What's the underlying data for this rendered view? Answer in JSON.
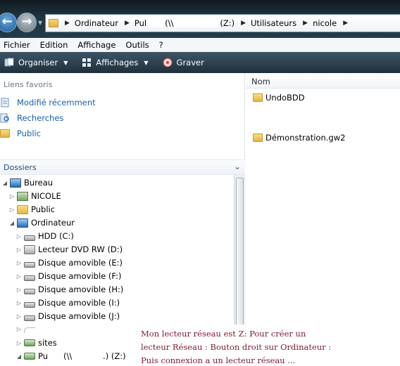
{
  "address_bar": {
    "crumbs": [
      "Ordinateur",
      "Pul",
      "(\\\\",
      "(Z:)",
      "Utilisateurs",
      "nicole"
    ]
  },
  "menu": [
    "Fichier",
    "Edition",
    "Affichage",
    "Outils",
    "?"
  ],
  "toolbar": {
    "organize": "Organiser",
    "views": "Affichages",
    "burn": "Graver"
  },
  "favorites": {
    "title": "Liens favoris",
    "items": [
      {
        "label": "Modifié récemment",
        "icon": "recent-icon"
      },
      {
        "label": "Recherches",
        "icon": "search-icon"
      },
      {
        "label": "Public",
        "icon": "folder-icon"
      }
    ]
  },
  "folders": {
    "title": "Dossiers",
    "tree": [
      {
        "label": "Bureau",
        "icon": "desktop-icon",
        "expanded": true
      },
      {
        "label": "NICOLE",
        "icon": "user-icon",
        "expanded": false
      },
      {
        "label": "Public",
        "icon": "folder-icon",
        "expanded": false
      },
      {
        "label": "Ordinateur",
        "icon": "computer-icon",
        "expanded": true
      },
      {
        "label": "HDD (C:)",
        "icon": "hdd-icon",
        "expanded": false
      },
      {
        "label": "Lecteur DVD RW (D:)",
        "icon": "dvd-icon",
        "expanded": false
      },
      {
        "label": "Disque amovible (E:)",
        "icon": "removable-icon",
        "expanded": false
      },
      {
        "label": "Disque amovible (F:)",
        "icon": "removable-icon",
        "expanded": false
      },
      {
        "label": "Disque amovible (H:)",
        "icon": "removable-icon",
        "expanded": false
      },
      {
        "label": "Disque amovible (I:)",
        "icon": "removable-icon",
        "expanded": false
      },
      {
        "label": "Disque amovible (J:)",
        "icon": "removable-icon",
        "expanded": false
      },
      {
        "label": "",
        "icon": "removable-icon",
        "expanded": false
      },
      {
        "label": "sites",
        "icon": "network-drive-icon",
        "expanded": false
      },
      {
        "label": "Pu      (\\\\            .) (Z:)",
        "icon": "network-drive-icon",
        "expanded": true
      }
    ]
  },
  "content": {
    "column_name": "Nom",
    "items": [
      "UndoBDD",
      "Démonstration.gw2"
    ]
  },
  "annotation": {
    "lines": [
      "Mon lecteur réseau est Z: Pour créer un",
      "lecteur Réseau : Bouton droit sur Ordinateur :",
      "Puis connexion a un lecteur réseau ..."
    ]
  }
}
